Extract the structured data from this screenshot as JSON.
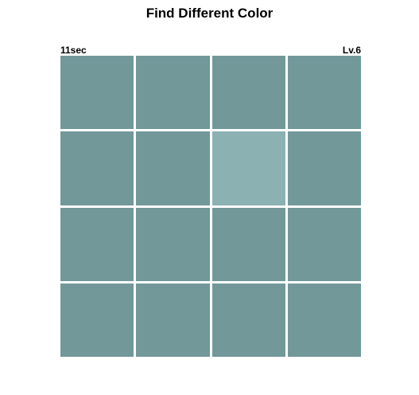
{
  "title": "Find Different Color",
  "hud": {
    "timer": "11sec",
    "level": "Lv.6"
  },
  "board": {
    "rows": 4,
    "cols": 4,
    "base_color": "#729899",
    "odd_color": "#8bb1b3",
    "odd_tile_index": 6
  }
}
